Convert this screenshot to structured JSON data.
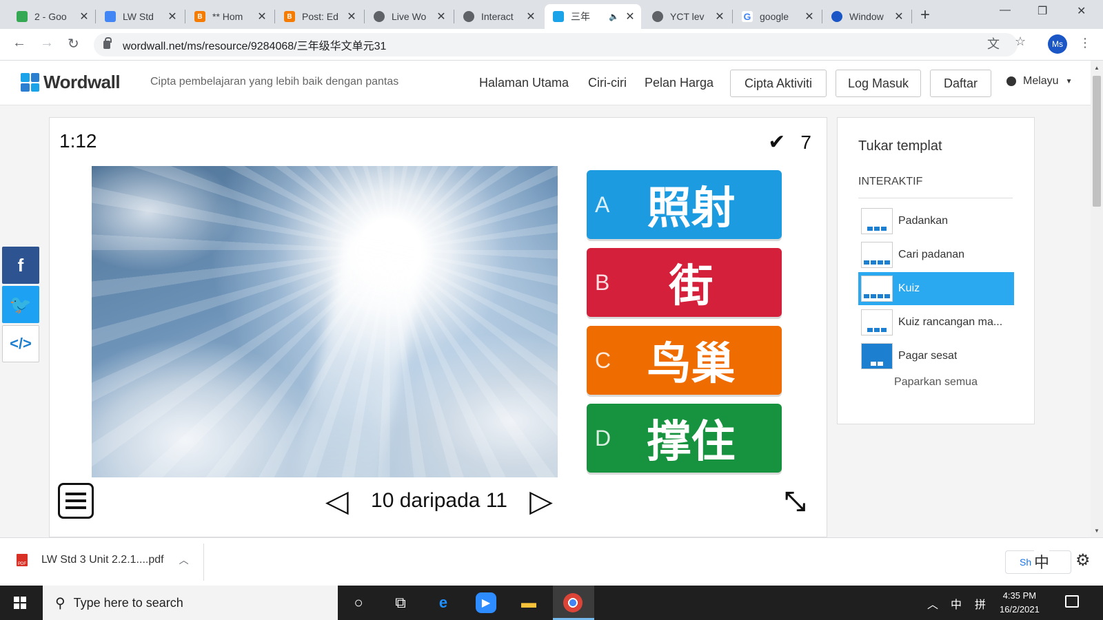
{
  "browser": {
    "tabs": [
      {
        "title": "2 - Goo",
        "favicon": "google-drive-icon",
        "color": "#34a853"
      },
      {
        "title": "LW Std",
        "favicon": "google-docs-icon",
        "color": "#4285f4"
      },
      {
        "title": "** Hom",
        "favicon": "blogger-icon",
        "color": "#f57c00"
      },
      {
        "title": "Post: Ed",
        "favicon": "blogger-icon",
        "color": "#f57c00"
      },
      {
        "title": "Live Wo",
        "favicon": "globe-icon",
        "color": "#5f6368"
      },
      {
        "title": "Interact",
        "favicon": "globe-icon",
        "color": "#5f6368"
      },
      {
        "title": "三年",
        "favicon": "wordwall-icon",
        "color": "#1aa3e8",
        "active": true
      },
      {
        "title": "YCT lev",
        "favicon": "globe-icon",
        "color": "#5f6368"
      },
      {
        "title": "google",
        "favicon": "google-icon",
        "color": "#4285f4"
      },
      {
        "title": "Window",
        "favicon": "windows-icon",
        "color": "#1a56c6"
      }
    ],
    "url": "wordwall.net/ms/resource/9284068/三年级华文单元31",
    "profile_initials": "Ms"
  },
  "header": {
    "logo_text": "Wordwall",
    "tagline": "Cipta pembelajaran yang lebih baik dengan pantas",
    "nav": [
      "Halaman Utama",
      "Ciri-ciri",
      "Pelan Harga"
    ],
    "buttons": [
      "Cipta Aktiviti",
      "Log Masuk",
      "Daftar"
    ],
    "language": "Melayu"
  },
  "activity": {
    "timer": "1:12",
    "score": "7",
    "answers": [
      {
        "letter": "A",
        "word": "照射",
        "color": "#1c9be0"
      },
      {
        "letter": "B",
        "word": "街",
        "color": "#d4203a"
      },
      {
        "letter": "C",
        "word": "鸟巢",
        "color": "#ef6c00"
      },
      {
        "letter": "D",
        "word": "撑住",
        "color": "#17923e"
      }
    ],
    "pager_text": "10 daripada 11"
  },
  "template_panel": {
    "title": "Tukar templat",
    "section": "INTERAKTIF",
    "items": [
      {
        "label": "Padankan",
        "active": false
      },
      {
        "label": "Cari padanan",
        "active": false
      },
      {
        "label": "Kuiz",
        "active": true
      },
      {
        "label": "Kuiz rancangan ma...",
        "active": false
      },
      {
        "label": "Pagar sesat",
        "active": false
      }
    ],
    "show_all": "Paparkan semua"
  },
  "download_bar": {
    "filename": "LW Std 3 Unit 2.2.1....pdf",
    "show_all": "Sh",
    "ime_char": "中"
  },
  "taskbar": {
    "search_placeholder": "Type here to search",
    "time": "4:35 PM",
    "date": "16/2/2021",
    "tray_ime": "中",
    "tray_layout": "拼"
  }
}
